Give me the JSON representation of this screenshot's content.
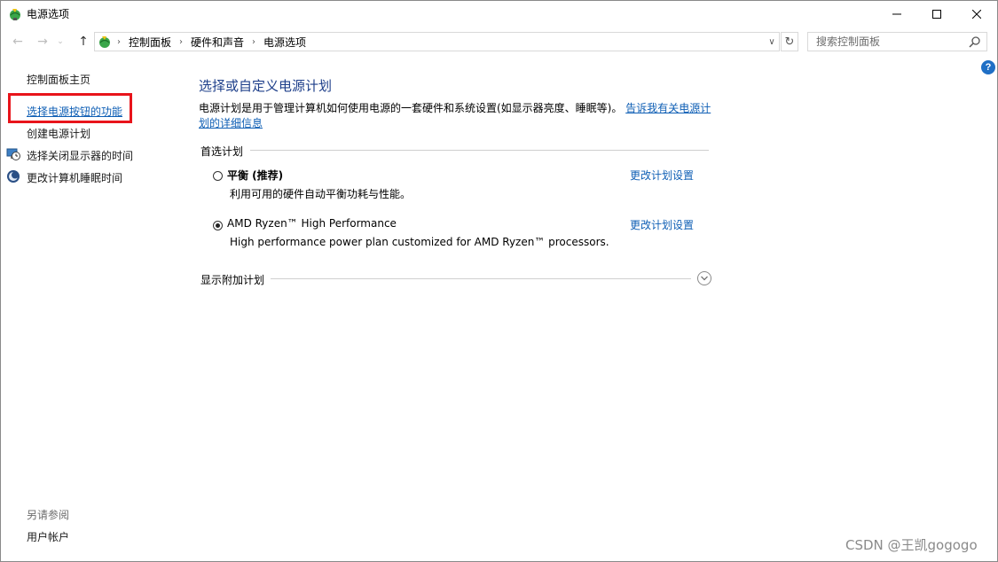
{
  "window": {
    "title": "电源选项"
  },
  "nav": {
    "breadcrumbs": [
      "控制面板",
      "硬件和声音",
      "电源选项"
    ],
    "search_placeholder": "搜索控制面板"
  },
  "sidebar": {
    "home": "控制面板主页",
    "items": [
      {
        "label": "选择电源按钮的功能",
        "icon": ""
      },
      {
        "label": "创建电源计划",
        "icon": ""
      },
      {
        "label": "选择关闭显示器的时间",
        "icon": "monitor-clock-icon"
      },
      {
        "label": "更改计算机睡眠时间",
        "icon": "moon-icon"
      }
    ],
    "see_also_header": "另请参阅",
    "see_also_items": [
      "用户帐户"
    ]
  },
  "main": {
    "title": "选择或自定义电源计划",
    "description": "电源计划是用于管理计算机如何使用电源的一套硬件和系统设置(如显示器亮度、睡眠等)。",
    "description_link": "告诉我有关电源计划的详细信息",
    "preferred_header": "首选计划",
    "plans": [
      {
        "name": "平衡 (推荐)",
        "description": "利用可用的硬件自动平衡功耗与性能。",
        "link": "更改计划设置",
        "selected": false
      },
      {
        "name": "AMD Ryzen™ High Performance",
        "description": "High performance power plan customized for AMD Ryzen™ processors.",
        "link": "更改计划设置",
        "selected": true
      }
    ],
    "additional_header": "显示附加计划"
  },
  "watermark": "CSDN @王凯gogogo",
  "colors": {
    "link": "#0f5fb5",
    "title": "#1e3f8a",
    "highlight_box": "#e8141b"
  }
}
